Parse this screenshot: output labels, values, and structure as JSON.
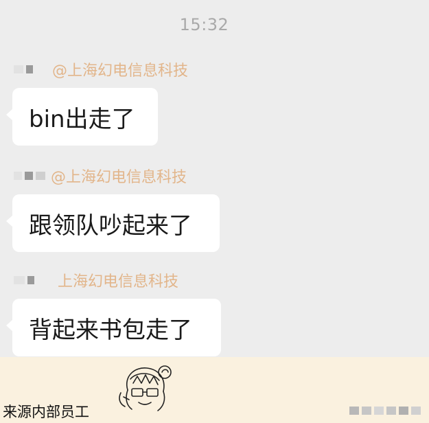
{
  "chat": {
    "timestamp": "15:32",
    "messages": [
      {
        "sender": "@上海幻电信息科技",
        "text": "bin出走了"
      },
      {
        "sender": "@上海幻电信息科技",
        "text": "跟领队吵起来了"
      },
      {
        "sender": "上海幻电信息科技",
        "text": "背起来书包走了"
      }
    ]
  },
  "caption": {
    "text": "来源内部员工"
  },
  "colors": {
    "chat_background": "#ededed",
    "bubble": "#ffffff",
    "sender_name": "#e2b58a",
    "caption_bar": "#faf1df"
  },
  "icons": {
    "sticker": "anime-girl-sticker-icon",
    "watermark": "pixelated-watermark-icon"
  }
}
